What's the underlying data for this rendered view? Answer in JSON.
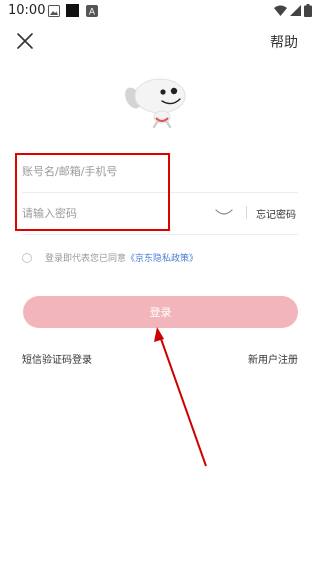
{
  "status_bar": {
    "time": "10:00",
    "icons": [
      "gallery-icon",
      "square-notification-icon",
      "a-badge-icon",
      "wifi-icon",
      "cellular-signal-icon",
      "battery-icon"
    ]
  },
  "header": {
    "close_icon": "close-icon",
    "help_label": "帮助"
  },
  "mascot": {
    "icon": "jd-dog-mascot-icon"
  },
  "form": {
    "account_placeholder": "账号名/邮箱/手机号",
    "password_placeholder": "请输入密码",
    "password_visibility_icon": "eye-closed-icon",
    "forgot_password_label": "忘记密码"
  },
  "agreement": {
    "prefix": "登录即代表您已同意",
    "policy_link": "《京东隐私政策》",
    "checked": false
  },
  "login_button_label": "登录",
  "footer": {
    "sms_login_label": "短信验证码登录",
    "register_label": "新用户注册"
  },
  "annotations": {
    "highlight_color": "#e00000",
    "arrow_color": "#cc0000"
  },
  "colors": {
    "login_button_bg": "#f2b5bb",
    "policy_link": "#4a7fd6"
  }
}
